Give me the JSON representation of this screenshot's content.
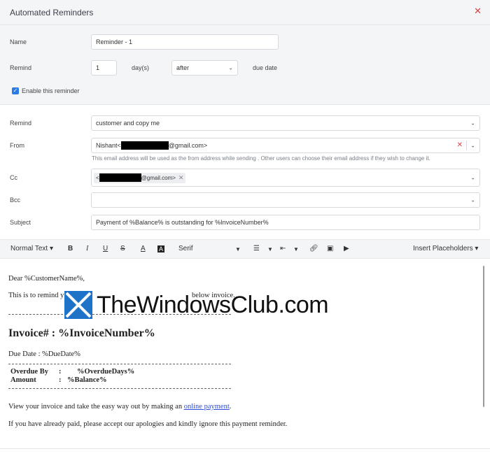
{
  "dialog": {
    "title": "Automated Reminders",
    "close_glyph": "✕"
  },
  "top": {
    "name_label": "Name",
    "name_value": "Reminder - 1",
    "remind_label": "Remind",
    "remind_days": "1",
    "days_unit": "day(s)",
    "timing_value": "after",
    "due_label": "due date",
    "enable_label": "Enable this reminder"
  },
  "mid": {
    "recipient_label": "Remind",
    "recipient_value": "customer and copy me",
    "from_label": "From",
    "from_prefix": "Nishant<",
    "from_suffix": "@gmail.com>",
    "from_helper": "This email address will be used as the from address while sending . Other users can choose their email address if they wish to change it.",
    "cc_label": "Cc",
    "cc_prefix": "<",
    "cc_suffix": "@gmail.com>",
    "bcc_label": "Bcc",
    "subject_label": "Subject",
    "subject_value": "Payment of %Balance% is outstanding for %InvoiceNumber%"
  },
  "toolbar": {
    "text_style": "Normal Text",
    "bold": "B",
    "italic": "I",
    "underline": "U",
    "strike": "S",
    "font_color": "A",
    "bg_color": "A",
    "font": "Serif",
    "insert_placeholders": "Insert Placeholders"
  },
  "editor": {
    "greeting": "Dear %CustomerName%,",
    "reminder_start": "This is to remind y",
    "reminder_end": " below invoice.",
    "heading": "Invoice# : %InvoiceNumber%",
    "due_date": "Due Date :   %DueDate%",
    "overdue_label": "Overdue By",
    "overdue_value": "%OverdueDays%",
    "amount_label": "Amount",
    "amount_value": "%Balance%",
    "colon": ":",
    "view_text": "View your invoice and take the easy way out by making an ",
    "payment_link": "online payment",
    "view_end": ".",
    "apology": "If you have already paid, please accept our apologies and kindly ignore this payment reminder."
  },
  "watermark": {
    "text": "TheWindowsClub.com"
  },
  "colors": {
    "accent": "#2c7be5",
    "close": "#e23b3b",
    "link": "#2a4bd7"
  }
}
